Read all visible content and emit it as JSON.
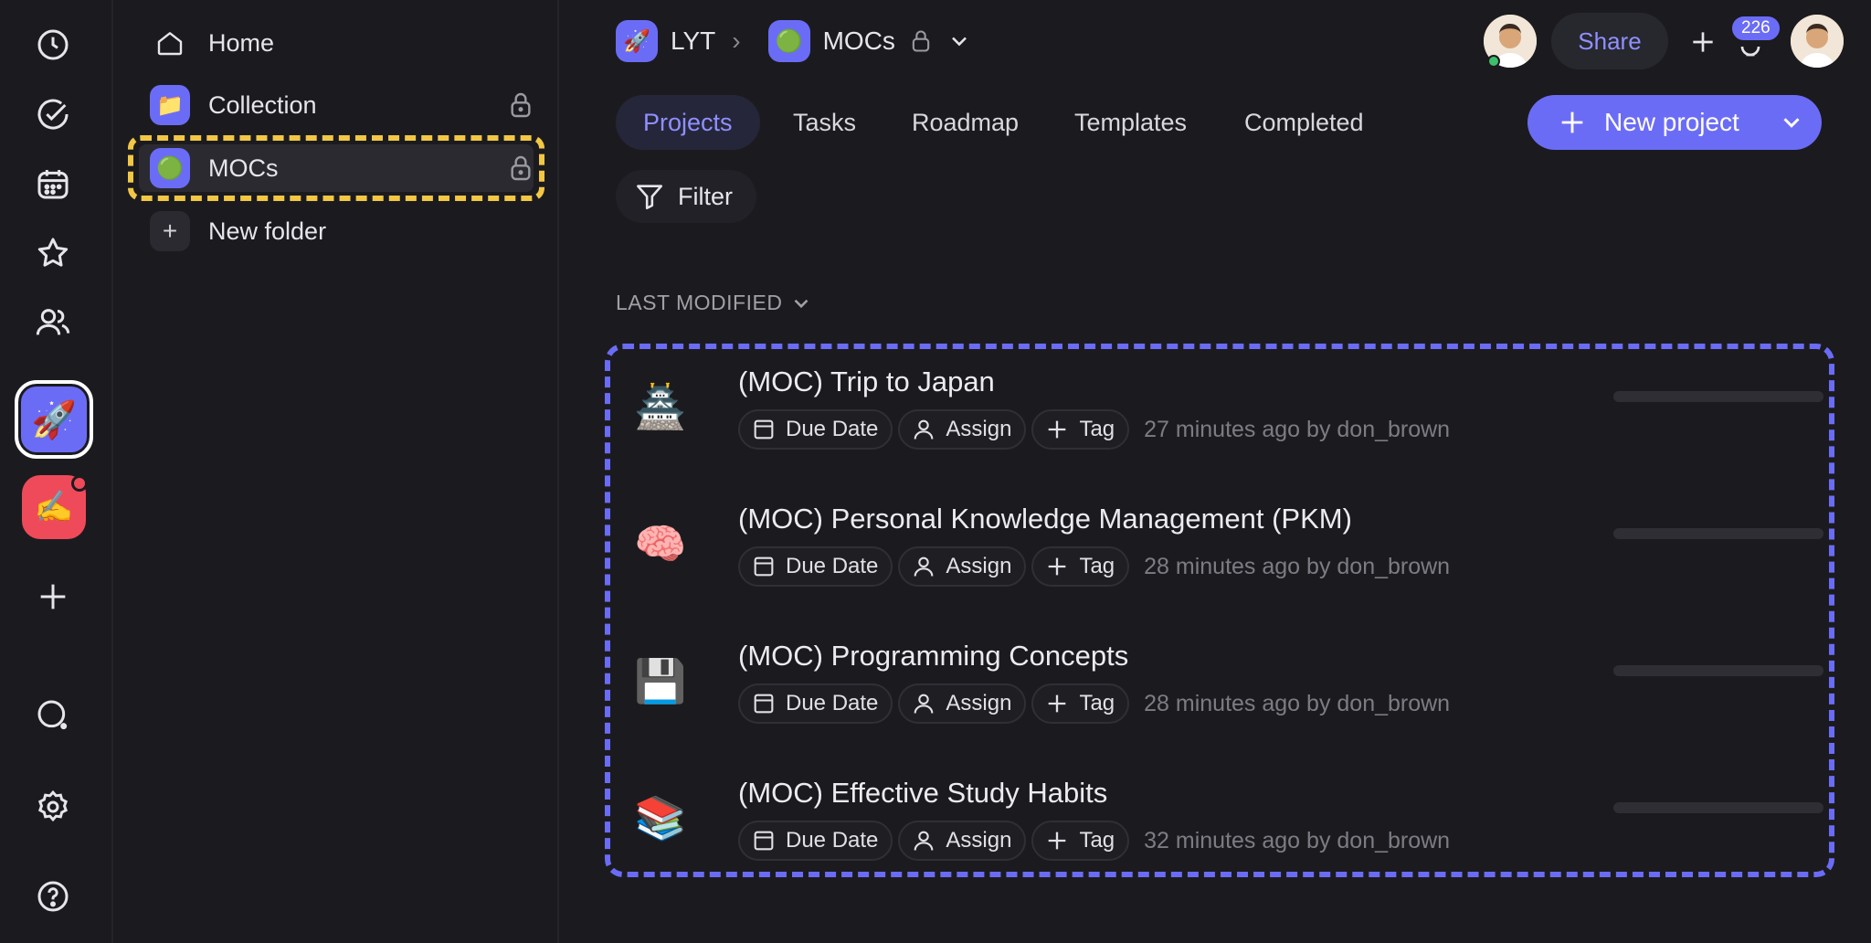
{
  "breadcrumb": {
    "workspace": "LYT",
    "workspace_icon": "🚀",
    "separator": "›",
    "folder": "MOCs",
    "folder_icon": "🟢"
  },
  "header": {
    "share_label": "Share",
    "notification_count": "226"
  },
  "sidebar": {
    "home_label": "Home",
    "folders": [
      {
        "label": "Collection",
        "icon": "📁",
        "locked": true
      },
      {
        "label": "MOCs",
        "icon": "🟢",
        "locked": true,
        "selected": true
      }
    ],
    "new_folder_label": "New folder"
  },
  "rail": {
    "workspaces": [
      {
        "icon": "🚀",
        "active": true
      },
      {
        "icon": "✍️",
        "active": false,
        "has_notification": true
      }
    ]
  },
  "tabs": [
    {
      "label": "Projects",
      "active": true
    },
    {
      "label": "Tasks"
    },
    {
      "label": "Roadmap"
    },
    {
      "label": "Templates"
    },
    {
      "label": "Completed"
    }
  ],
  "toolbar": {
    "new_project_label": "New project",
    "filter_label": "Filter"
  },
  "list": {
    "sort_label": "LAST MODIFIED",
    "chip_due_date": "Due Date",
    "chip_assign": "Assign",
    "chip_tag": "Tag",
    "items": [
      {
        "icon": "🏯",
        "title": "(MOC) Trip to Japan",
        "meta": "27 minutes ago by don_brown"
      },
      {
        "icon": "🧠",
        "title": "(MOC) Personal Knowledge Management (PKM)",
        "meta": "28 minutes ago by don_brown"
      },
      {
        "icon": "💾",
        "title": "(MOC) Programming Concepts",
        "meta": "28 minutes ago by don_brown"
      },
      {
        "icon": "📚",
        "title": "(MOC) Effective Study Habits",
        "meta": "32 minutes ago by don_brown"
      }
    ]
  },
  "colors": {
    "accent": "#6b6cf6",
    "folder_highlight": "#f2c744",
    "background": "#1b1b1f"
  }
}
